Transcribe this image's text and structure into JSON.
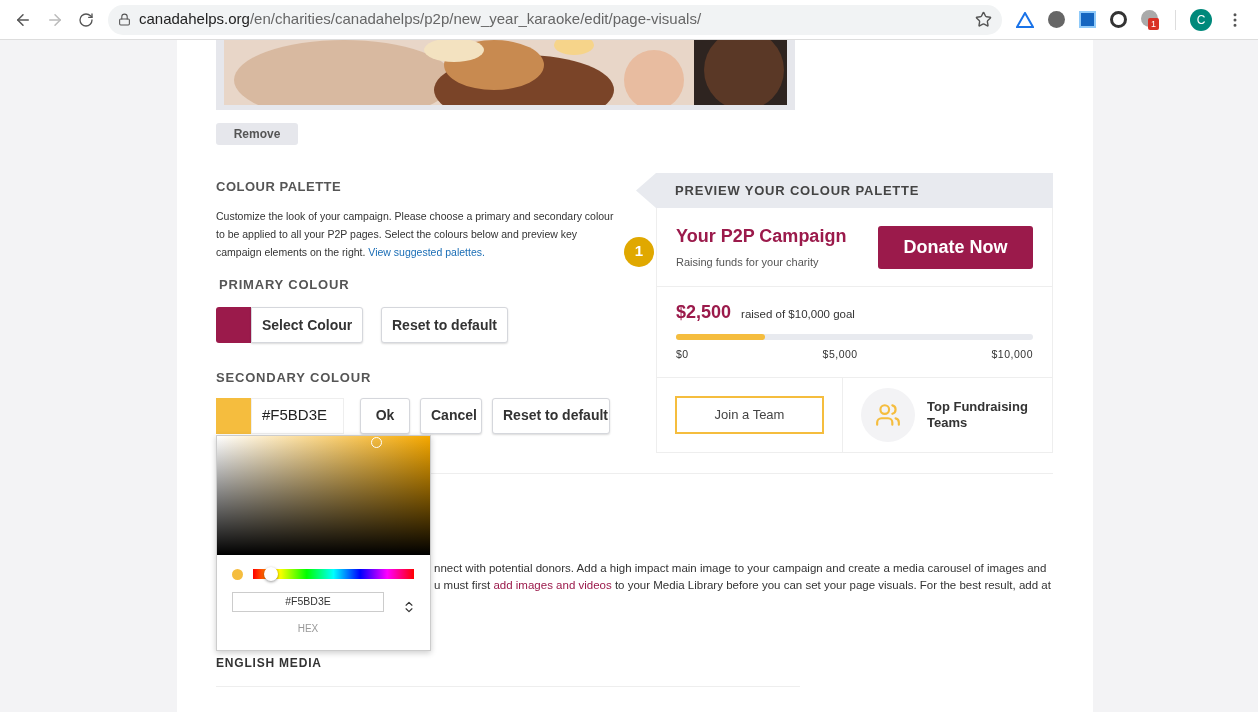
{
  "browser": {
    "url_host": "canadahelps.org",
    "url_path": "/en/charities/canadahelps/p2p/new_year_karaoke/edit/page-visuals/",
    "extension_badge": "1",
    "profile_initial": "C"
  },
  "media": {
    "remove_button": "Remove"
  },
  "palette": {
    "title": "COLOUR PALETTE",
    "description": "Customize the look of your campaign. Please choose a primary and secondary colour to be applied to all your P2P pages. Select the colours below and preview key campaign elements on the right.",
    "link": "View suggested palettes.",
    "step_badge": "1",
    "primary": {
      "label": "PRIMARY COLOUR",
      "color": "#9b1a4b",
      "select_button": "Select Colour",
      "reset_button": "Reset to default"
    },
    "secondary": {
      "label": "SECONDARY COLOUR",
      "color": "#f5bd3e",
      "value": "#F5BD3E",
      "ok_button": "Ok",
      "cancel_button": "Cancel",
      "reset_button": "Reset to default"
    }
  },
  "picker": {
    "hex_value": "#F5BD3E",
    "mode_label": "HEX",
    "level": 0.11
  },
  "preview": {
    "title": "PREVIEW YOUR COLOUR PALETTE",
    "campaign_title": "Your P2P Campaign",
    "campaign_subtitle": "Raising funds for your charity",
    "donate_button": "Donate Now",
    "raised": "$2,500",
    "goal_text": "raised of $10,000 goal",
    "level": 0.25,
    "ticks": [
      "$0",
      "$5,000",
      "$10,000"
    ],
    "join_button": "Join a Team",
    "top_teams": "Top Fundraising Teams"
  },
  "media_section": {
    "line_1": "nnect with potential donors. Add a high impact main image to your campaign and create a media carousel of images and",
    "line_2_start": "u must first ",
    "link": "add images and videos",
    "line_2_end": " to your Media Library before you can set your page visuals. For the best result, add at",
    "heading": "ENGLISH MEDIA"
  }
}
